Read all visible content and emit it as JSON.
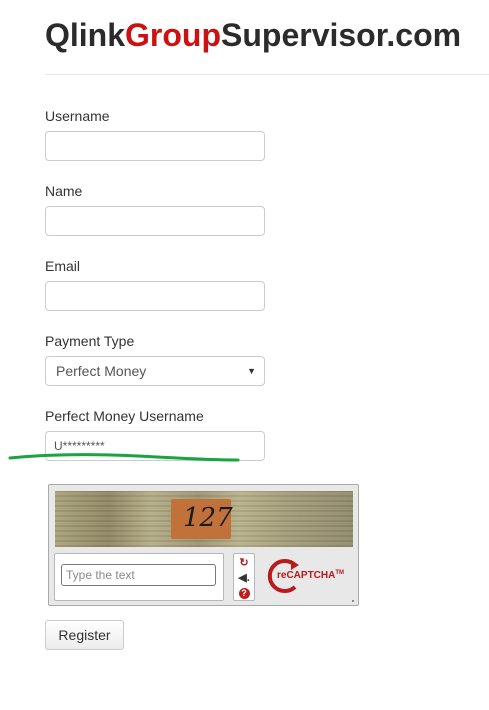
{
  "header": {
    "logo_part1": "Qlink",
    "logo_part2": "Group",
    "logo_part3": "Supervisor.com"
  },
  "form": {
    "username": {
      "label": "Username",
      "value": ""
    },
    "name": {
      "label": "Name",
      "value": ""
    },
    "email": {
      "label": "Email",
      "value": ""
    },
    "payment_type": {
      "label": "Payment Type",
      "selected": "Perfect Money"
    },
    "pm_username": {
      "label": "Perfect Money Username",
      "value": "U*********"
    }
  },
  "captcha": {
    "challenge_text": "127",
    "input_placeholder": "Type the text",
    "brand_prefix": "re",
    "brand_name": "CAPTCHA",
    "brand_tm": "TM",
    "help_symbol": "?"
  },
  "actions": {
    "register_label": "Register"
  },
  "colors": {
    "accent": "#cc1111",
    "annotation": "#1aa340",
    "recaptcha_red": "#b81b1b"
  },
  "icons": {
    "reload": "reload-icon",
    "audio": "audio-icon",
    "help": "help-icon"
  }
}
